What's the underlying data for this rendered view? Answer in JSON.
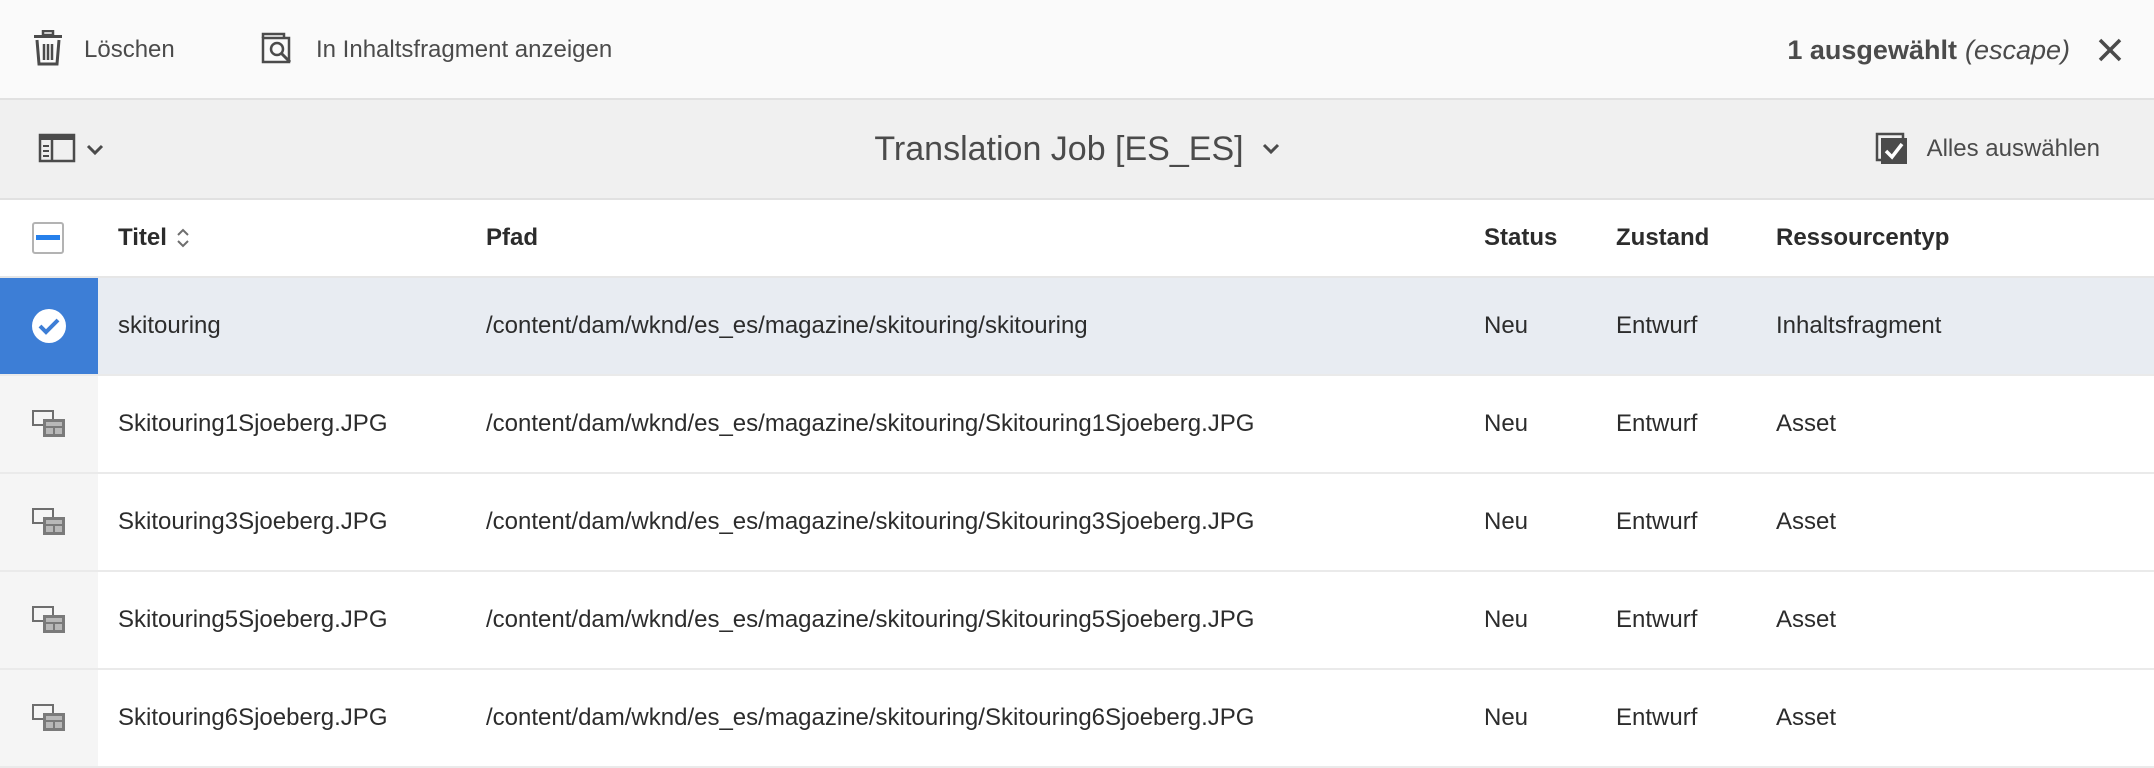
{
  "actionbar": {
    "delete_label": "Löschen",
    "show_in_fragment_label": "In Inhaltsfragment anzeigen",
    "selection_count": "1 ausgewählt",
    "selection_escape": "(escape)"
  },
  "titlebar": {
    "title": "Translation Job [ES_ES]",
    "select_all_label": "Alles auswählen"
  },
  "table": {
    "headers": {
      "title": "Titel",
      "path": "Pfad",
      "status": "Status",
      "state": "Zustand",
      "resource_type": "Ressourcentyp"
    },
    "rows": [
      {
        "title": "skitouring",
        "path": "/content/dam/wknd/es_es/magazine/skitouring/skitouring",
        "status": "Neu",
        "state": "Entwurf",
        "type": "Inhaltsfragment",
        "selected": true
      },
      {
        "title": "Skitouring1Sjoeberg.JPG",
        "path": "/content/dam/wknd/es_es/magazine/skitouring/Skitouring1Sjoeberg.JPG",
        "status": "Neu",
        "state": "Entwurf",
        "type": "Asset",
        "selected": false
      },
      {
        "title": "Skitouring3Sjoeberg.JPG",
        "path": "/content/dam/wknd/es_es/magazine/skitouring/Skitouring3Sjoeberg.JPG",
        "status": "Neu",
        "state": "Entwurf",
        "type": "Asset",
        "selected": false
      },
      {
        "title": "Skitouring5Sjoeberg.JPG",
        "path": "/content/dam/wknd/es_es/magazine/skitouring/Skitouring5Sjoeberg.JPG",
        "status": "Neu",
        "state": "Entwurf",
        "type": "Asset",
        "selected": false
      },
      {
        "title": "Skitouring6Sjoeberg.JPG",
        "path": "/content/dam/wknd/es_es/magazine/skitouring/Skitouring6Sjoeberg.JPG",
        "status": "Neu",
        "state": "Entwurf",
        "type": "Asset",
        "selected": false
      }
    ]
  },
  "icons": {
    "delete": "trash-icon",
    "show_in_fragment": "search-in-page-icon",
    "close": "close-icon",
    "rail": "rail-toggle-icon",
    "chevron": "chevron-down-icon",
    "select_all": "checkbox-checked-icon",
    "sort": "sort-icon",
    "selected_row": "check-circle-icon",
    "asset_thumb": "image-asset-icon"
  },
  "colors": {
    "accent": "#2680eb",
    "selected_row_bg": "#e8ecf2",
    "selected_thumb_bg": "#3d7ed6"
  }
}
